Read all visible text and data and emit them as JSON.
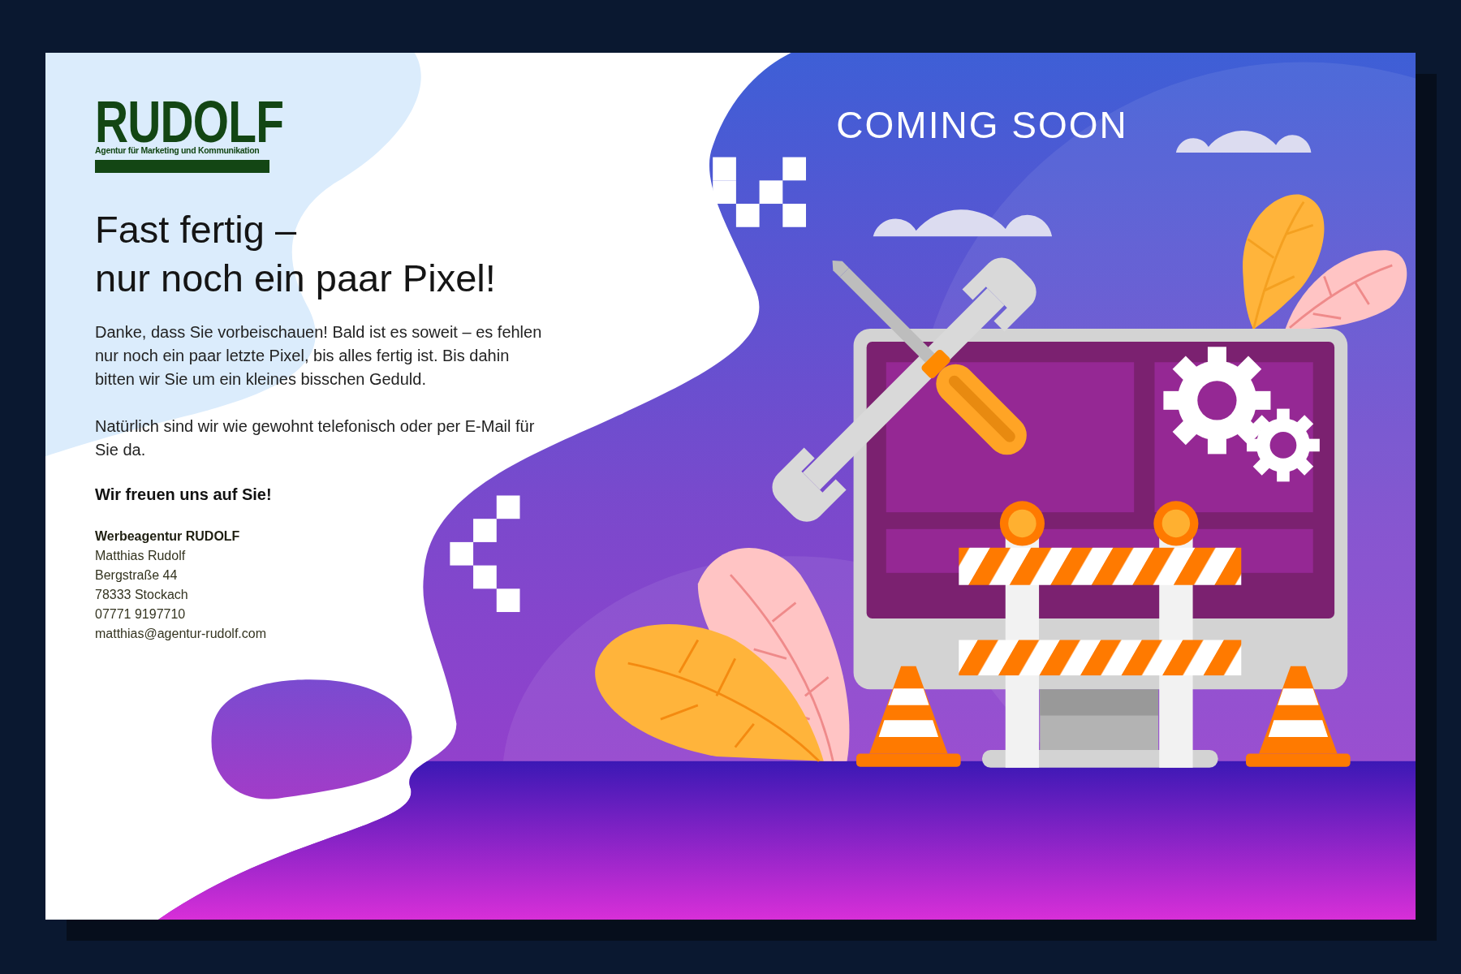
{
  "logo": {
    "name": "RUDOLF",
    "tagline": "Agentur für Marketing und Kommunikation"
  },
  "headline": [
    "Fast fertig –",
    "nur noch ein paar Pixel!"
  ],
  "paragraphs": [
    "Danke, dass Sie vorbeischauen! Bald ist es soweit – es fehlen nur noch ein paar letzte Pixel, bis alles fertig ist. Bis dahin bitten wir Sie um ein kleines bisschen Geduld.",
    "Natürlich sind wir wie gewohnt telefonisch oder per E-Mail für Sie da."
  ],
  "closing": "Wir freuen uns auf Sie!",
  "contact": {
    "company": "Werbeagentur RUDOLF",
    "lines": [
      "Matthias Rudolf",
      "Bergstraße 44",
      "78333 Stockach",
      "07771 9197710",
      "matthias@agentur-rudolf.com"
    ]
  },
  "banner": "COMING SOON"
}
